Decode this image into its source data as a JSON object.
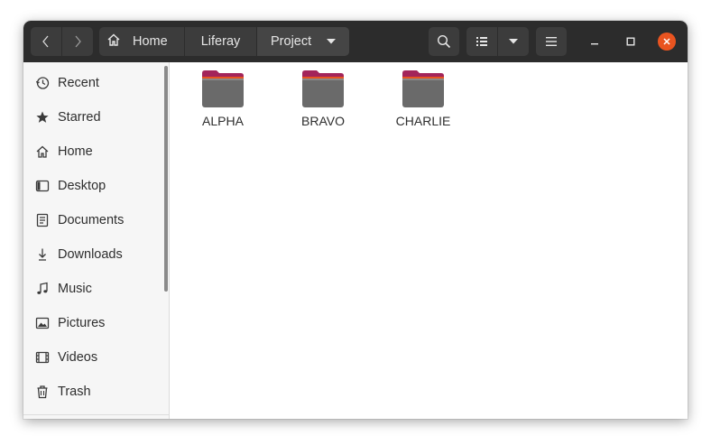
{
  "window": {
    "accent_color": "#e95420",
    "headerbar_color": "#2c2c2c"
  },
  "header": {
    "back_icon": "chevron-left-icon",
    "forward_icon": "chevron-right-icon",
    "breadcrumbs": [
      {
        "label": "Home",
        "icon": "home-icon"
      },
      {
        "label": "Liferay"
      },
      {
        "label": "Project"
      }
    ],
    "search_icon": "search-icon",
    "view_icon": "list-view-icon",
    "menu_icon": "hamburger-menu-icon"
  },
  "sidebar": {
    "items": [
      {
        "label": "Recent",
        "icon": "clock-icon"
      },
      {
        "label": "Starred",
        "icon": "star-icon"
      },
      {
        "label": "Home",
        "icon": "home-icon"
      },
      {
        "label": "Desktop",
        "icon": "desktop-icon"
      },
      {
        "label": "Documents",
        "icon": "document-icon"
      },
      {
        "label": "Downloads",
        "icon": "download-icon"
      },
      {
        "label": "Music",
        "icon": "music-icon"
      },
      {
        "label": "Pictures",
        "icon": "picture-icon"
      },
      {
        "label": "Videos",
        "icon": "video-icon"
      },
      {
        "label": "Trash",
        "icon": "trash-icon"
      }
    ]
  },
  "main": {
    "folders": [
      {
        "name": "ALPHA"
      },
      {
        "name": "BRAVO"
      },
      {
        "name": "CHARLIE"
      }
    ]
  }
}
